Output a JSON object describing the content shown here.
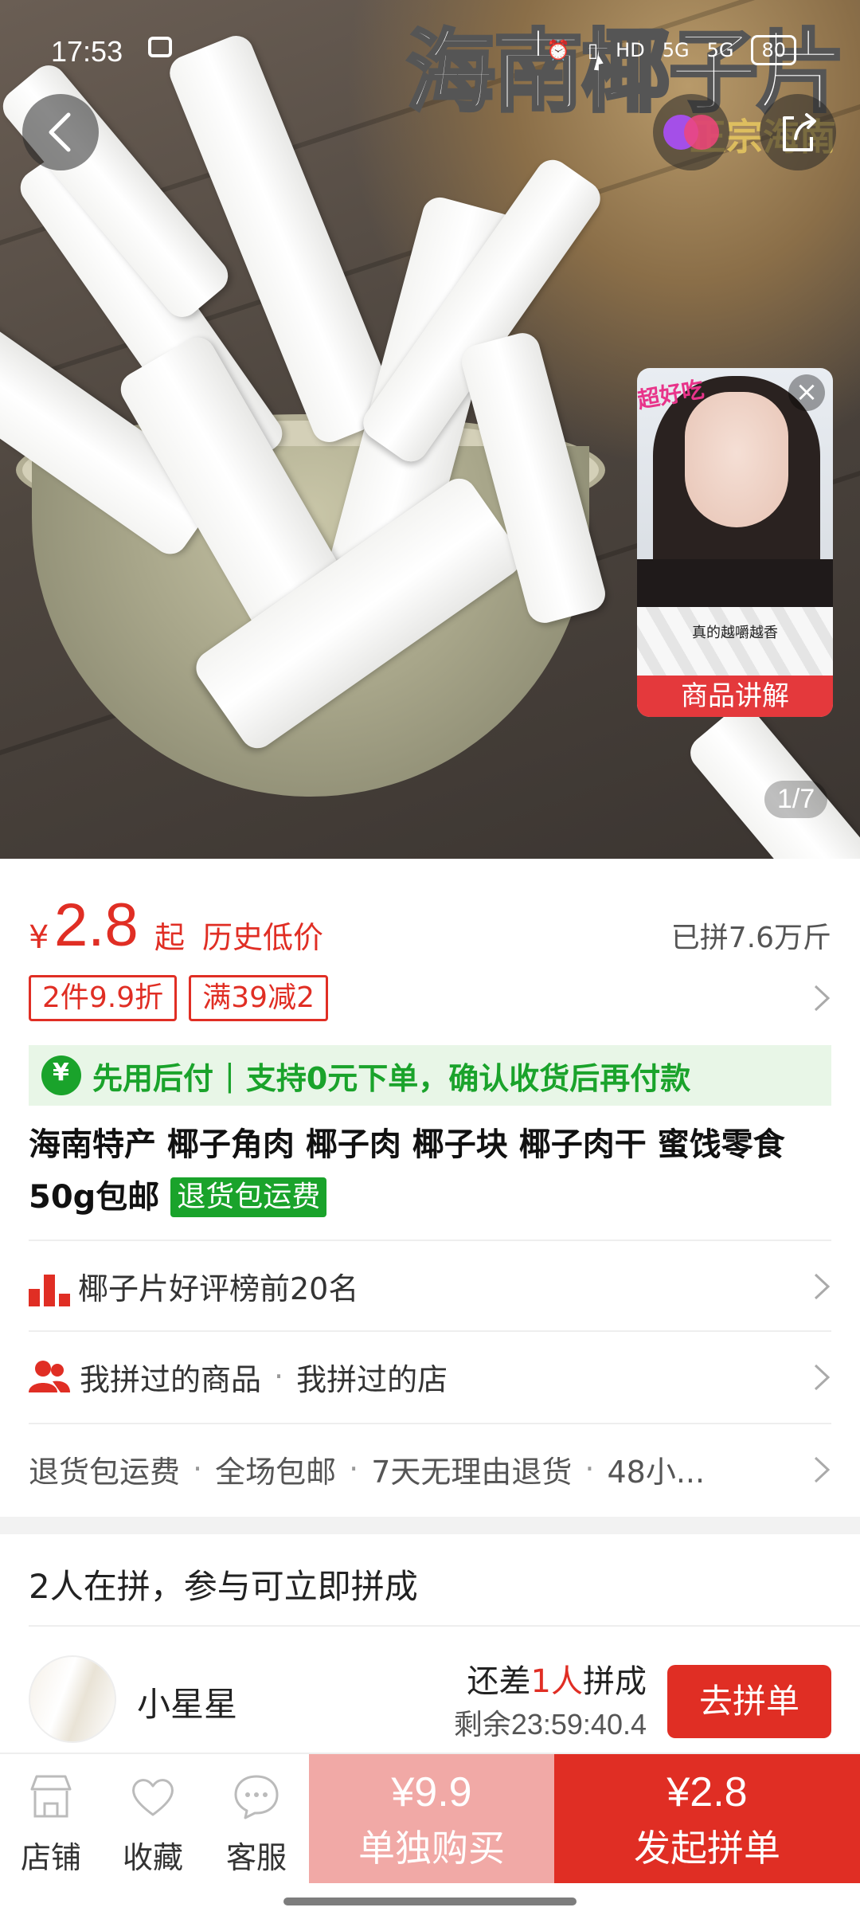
{
  "status_bar": {
    "time": "17:53",
    "battery": "80",
    "net1": "5G",
    "net2": "5G",
    "hd": "HD"
  },
  "hero": {
    "title_art": "海南椰子片",
    "subtitle_art": "正宗海南",
    "image_counter": "1/7",
    "live_popup": {
      "sticker": "超好吃",
      "caption": "真的越嚼越香",
      "label": "商品讲解"
    }
  },
  "price": {
    "currency": "¥",
    "amount": "2.8",
    "suffix": "起",
    "tag": "历史低价",
    "sold": "已拼7.6万斤"
  },
  "coupons": [
    "2件9.9折",
    "满39减2"
  ],
  "pay_after": {
    "title": "先用后付",
    "sep": "|",
    "desc": "支持0元下单，确认收货后再付款"
  },
  "product": {
    "title": "海南特产  椰子角肉  椰子肉  椰子块 椰子肉干 蜜饯零食50g包邮",
    "tag": "退货包运费"
  },
  "rows": {
    "rank": "椰子片好评榜前20名",
    "history_a": "我拼过的商品",
    "history_b": "我拼过的店",
    "services": [
      "退货包运费",
      "全场包邮",
      "7天无理由退货",
      "48小..."
    ]
  },
  "group": {
    "title": "2人在拼，参与可立即拼成",
    "user": "小星星",
    "need_prefix": "还差",
    "need_count": "1人",
    "need_suffix": "拼成",
    "remain": "剩余23:59:40.4",
    "join": "去拼单"
  },
  "bottom": {
    "shop": "店铺",
    "fav": "收藏",
    "service": "客服",
    "alone_price": "¥9.9",
    "alone_label": "单独购买",
    "group_price": "¥2.8",
    "group_label": "发起拼单"
  },
  "colors": {
    "accent": "#e02e24",
    "green": "#1aa32b"
  }
}
